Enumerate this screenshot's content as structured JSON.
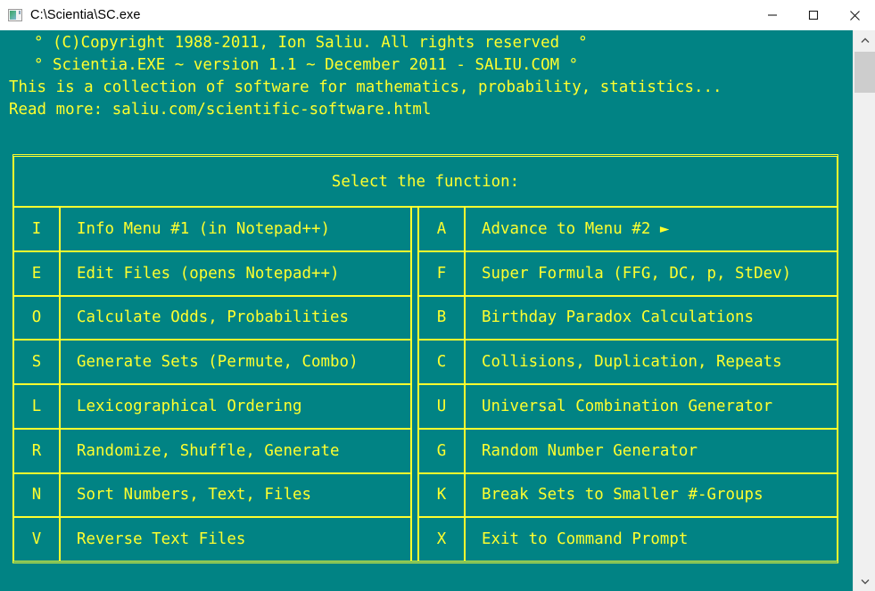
{
  "window": {
    "title": "C:\\Scientia\\SC.exe",
    "icon": "console-window-icon",
    "minimize_label": "Minimize",
    "maximize_label": "Maximize",
    "close_label": "Close"
  },
  "colors": {
    "console_background": "#018384",
    "console_text": "#ffff2e",
    "titlebar_background": "#ffffff",
    "titlebar_text": "#000000",
    "scrollbar_track": "#f0f0f0",
    "scrollbar_thumb": "#cdcdcd"
  },
  "console": {
    "header_lines": [
      "° (C)Copyright 1988-2011, Ion Saliu. All rights reserved  °",
      "° Scientia.EXE ~ version 1.1 ~ December 2011 - SALIU.COM °",
      "This is a collection of software for mathematics, probability, statistics...",
      "Read more: saliu.com/scientific-software.html"
    ]
  },
  "menu": {
    "title": "Select the function:",
    "left_column": [
      {
        "key": "I",
        "label": "Info Menu #1 (in Notepad++)"
      },
      {
        "key": "E",
        "label": "Edit Files (opens Notepad++)"
      },
      {
        "key": "O",
        "label": "Calculate Odds, Probabilities"
      },
      {
        "key": "S",
        "label": "Generate Sets (Permute, Combo)"
      },
      {
        "key": "L",
        "label": "Lexicographical Ordering"
      },
      {
        "key": "R",
        "label": "Randomize, Shuffle, Generate"
      },
      {
        "key": "N",
        "label": "Sort Numbers, Text, Files"
      },
      {
        "key": "V",
        "label": "Reverse Text Files"
      }
    ],
    "right_column": [
      {
        "key": "A",
        "label": "Advance to Menu #2 ►"
      },
      {
        "key": "F",
        "label": "Super Formula (FFG, DC, p, StDev)"
      },
      {
        "key": "B",
        "label": "Birthday Paradox Calculations"
      },
      {
        "key": "C",
        "label": "Collisions, Duplication, Repeats"
      },
      {
        "key": "U",
        "label": "Universal Combination Generator"
      },
      {
        "key": "G",
        "label": "Random Number Generator"
      },
      {
        "key": "K",
        "label": "Break Sets to Smaller #-Groups"
      },
      {
        "key": "X",
        "label": "Exit to Command Prompt"
      }
    ]
  },
  "scrollbar": {
    "up_arrow": "scroll-up-arrow",
    "down_arrow": "scroll-down-arrow",
    "thumb": "scroll-thumb"
  }
}
